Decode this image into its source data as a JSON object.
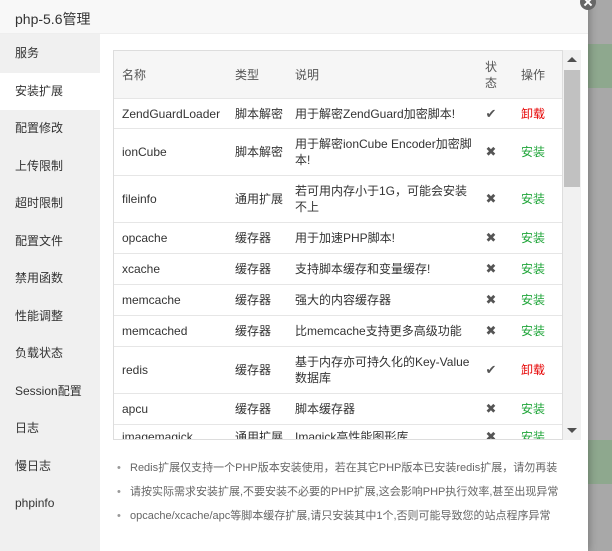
{
  "dialog": {
    "title": "php-5.6管理"
  },
  "colors": {
    "install": "#20a53a",
    "uninstall": "#e60000"
  },
  "sidebar": {
    "items": [
      {
        "label": "服务"
      },
      {
        "label": "安装扩展",
        "active": true
      },
      {
        "label": "配置修改"
      },
      {
        "label": "上传限制"
      },
      {
        "label": "超时限制"
      },
      {
        "label": "配置文件"
      },
      {
        "label": "禁用函数"
      },
      {
        "label": "性能调整"
      },
      {
        "label": "负载状态"
      },
      {
        "label": "Session配置"
      },
      {
        "label": "日志"
      },
      {
        "label": "慢日志"
      },
      {
        "label": "phpinfo"
      }
    ]
  },
  "table": {
    "headers": {
      "name": "名称",
      "type": "类型",
      "desc": "说明",
      "status": "状态",
      "op": "操作"
    },
    "rows": [
      {
        "name": "ZendGuardLoader",
        "type": "脚本解密",
        "desc": "用于解密ZendGuard加密脚本!",
        "installed": true,
        "op": "卸载"
      },
      {
        "name": "ionCube",
        "type": "脚本解密",
        "desc": "用于解密ionCube Encoder加密脚本!",
        "installed": false,
        "op": "安装"
      },
      {
        "name": "fileinfo",
        "type": "通用扩展",
        "desc": "若可用内存小于1G，可能会安装不上",
        "installed": false,
        "op": "安装"
      },
      {
        "name": "opcache",
        "type": "缓存器",
        "desc": "用于加速PHP脚本!",
        "installed": false,
        "op": "安装"
      },
      {
        "name": "xcache",
        "type": "缓存器",
        "desc": "支持脚本缓存和变量缓存!",
        "installed": false,
        "op": "安装"
      },
      {
        "name": "memcache",
        "type": "缓存器",
        "desc": "强大的内容缓存器",
        "installed": false,
        "op": "安装"
      },
      {
        "name": "memcached",
        "type": "缓存器",
        "desc": "比memcache支持更多高级功能",
        "installed": false,
        "op": "安装"
      },
      {
        "name": "redis",
        "type": "缓存器",
        "desc": "基于内存亦可持久化的Key-Value数据库",
        "installed": true,
        "op": "卸载"
      },
      {
        "name": "apcu",
        "type": "缓存器",
        "desc": "脚本缓存器",
        "installed": false,
        "op": "安装"
      },
      {
        "name": "imagemagick",
        "type": "通用扩展",
        "desc": "Imagick高性能图形库",
        "installed": false,
        "op": "安装"
      }
    ]
  },
  "notes": [
    "Redis扩展仅支持一个PHP版本安装使用，若在其它PHP版本已安装redis扩展，请勿再装",
    "请按实际需求安装扩展,不要安装不必要的PHP扩展,这会影响PHP执行效率,甚至出现异常",
    "opcache/xcache/apc等脚本缓存扩展,请只安装其中1个,否则可能导致您的站点程序异常"
  ]
}
